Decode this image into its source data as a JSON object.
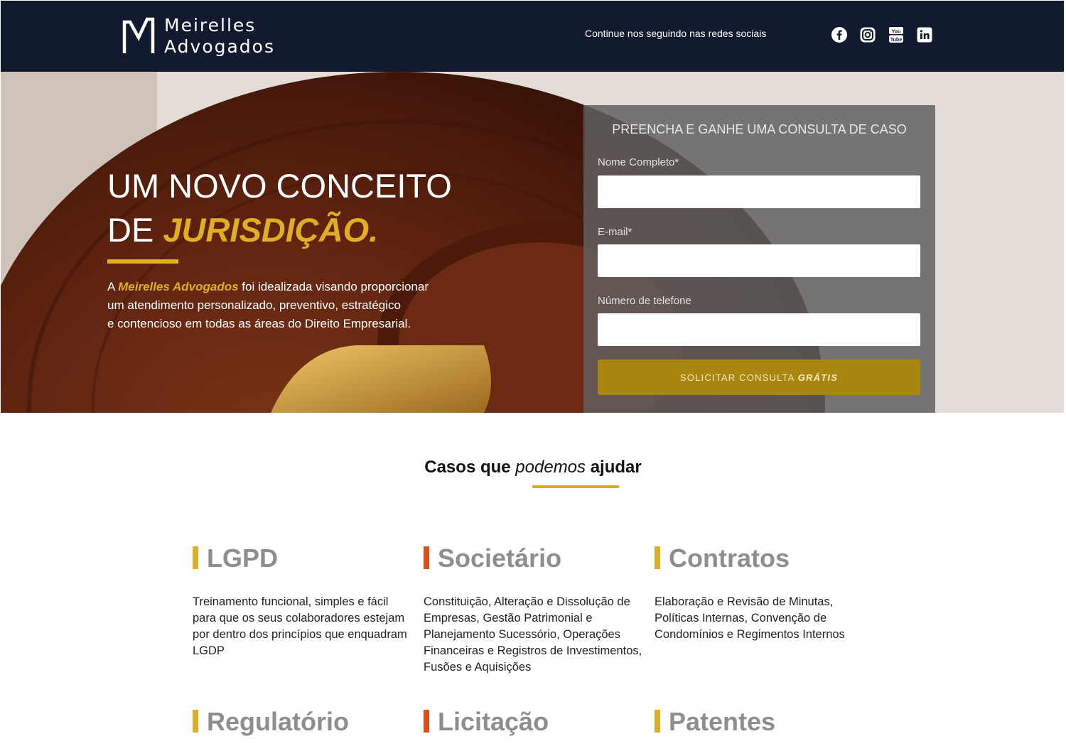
{
  "header": {
    "logo_line1": "Meirelles",
    "logo_line2": "Advogados",
    "social_text": "Continue nos seguindo nas redes sociais",
    "social_icons": [
      "facebook-icon",
      "instagram-icon",
      "youtube-icon",
      "linkedin-icon"
    ]
  },
  "hero": {
    "title_line1": "UM NOVO CONCEITO",
    "title_line2_prefix": "DE ",
    "title_line2_highlight": "JURISDIÇÃO.",
    "text_prefix": "A ",
    "text_highlight": "Meirelles Advogados",
    "text_line1_rest": " foi idealizada visando proporcionar",
    "text_line2": "um atendimento personalizado, preventivo, estratégico",
    "text_line3": "e contencioso em todas as áreas do Direito Empresarial."
  },
  "form": {
    "title": "PREENCHA E GANHE UMA CONSULTA DE CASO",
    "name_label": "Nome Completo*",
    "name_value": "",
    "email_label": "E-mail*",
    "email_value": "",
    "phone_label": "Número de telefone",
    "phone_value": "",
    "button_prefix": "SOLICITAR CONSULTA ",
    "button_bold": "GRÁTIS"
  },
  "services_section": {
    "title_part1": "Casos que ",
    "title_part2": "podemos",
    "title_part3": " ajudar",
    "items": [
      {
        "title": "LGPD",
        "description": "Treinamento funcional, simples e fácil para que os seus colaboradores estejam por dentro dos princípios que enquadram LGDP"
      },
      {
        "title": "Societário",
        "description": "Constituição, Alteração e Dissolução de Empresas, Gestão Patrimonial e Planejamento Sucessório, Operações Financeiras e Registros de Investimentos, Fusões e Aquisições"
      },
      {
        "title": "Contratos",
        "description": "Elaboração e Revisão de Minutas, Políticas Internas, Convenção de Condomínios e Regimentos Internos"
      },
      {
        "title": "Regulatório",
        "description": ""
      },
      {
        "title": "Licitação",
        "description": ""
      },
      {
        "title": "Patentes",
        "description": ""
      }
    ]
  },
  "colors": {
    "navy": "#111a2e",
    "gold": "#e0ae22",
    "button_gold": "#a8860f",
    "orange_accent": "#d9531c"
  }
}
